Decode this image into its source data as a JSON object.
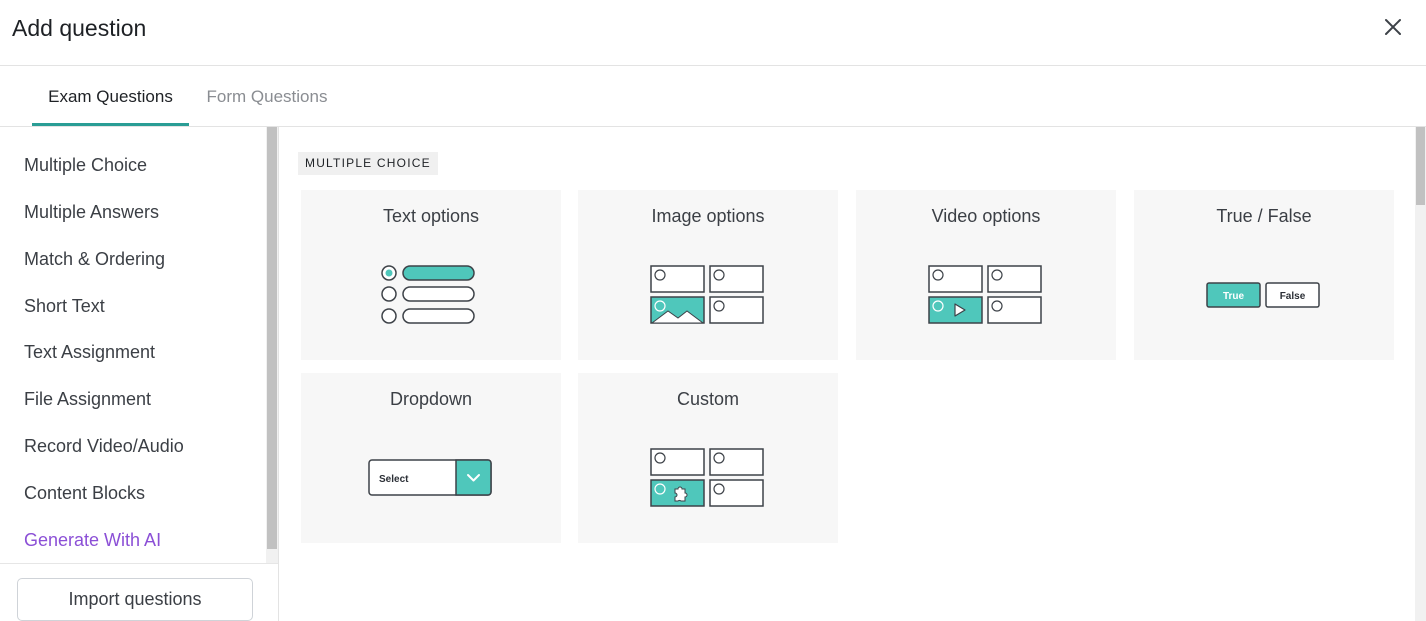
{
  "header": {
    "title": "Add question",
    "close_icon": "close-icon"
  },
  "tabs": [
    {
      "label": "Exam Questions",
      "active": true
    },
    {
      "label": "Form Questions",
      "active": false
    }
  ],
  "sidebar": {
    "items": [
      {
        "label": "Multiple Choice"
      },
      {
        "label": "Multiple Answers"
      },
      {
        "label": "Match & Ordering"
      },
      {
        "label": "Short Text"
      },
      {
        "label": "Text Assignment"
      },
      {
        "label": "File Assignment"
      },
      {
        "label": "Record Video/Audio"
      },
      {
        "label": "Content Blocks"
      },
      {
        "label": "Generate With AI"
      }
    ],
    "import_label": "Import questions"
  },
  "main": {
    "section_label": "MULTIPLE CHOICE",
    "cards": [
      {
        "title": "Text options"
      },
      {
        "title": "Image options"
      },
      {
        "title": "Video options"
      },
      {
        "title": "True / False",
        "true_label": "True",
        "false_label": "False"
      },
      {
        "title": "Dropdown",
        "select_label": "Select"
      },
      {
        "title": "Custom"
      }
    ]
  },
  "colors": {
    "accent": "#2a9d95",
    "teal_fill": "#4fc7bb",
    "ai_purple": "#8b4fd6",
    "outline": "#3d4248"
  }
}
